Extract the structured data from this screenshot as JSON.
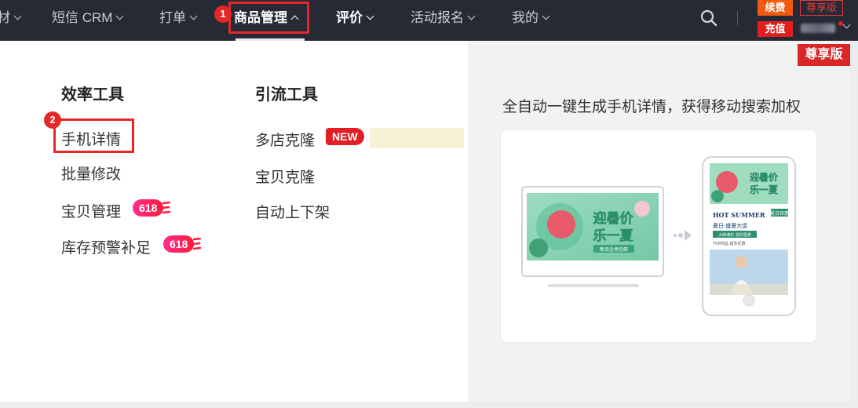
{
  "nav": {
    "items": [
      {
        "label": "材",
        "chevron": true
      },
      {
        "label": "短信 CRM",
        "chevron": true
      },
      {
        "label": "打单",
        "chevron": true
      },
      {
        "label": "商品管理",
        "chevron": "up",
        "active": true
      },
      {
        "label": "评价",
        "chevron": true
      },
      {
        "label": "活动报名",
        "chevron": true
      },
      {
        "label": "我的",
        "chevron": true
      }
    ],
    "step1": "1",
    "renew_label": "续费",
    "vip_outline_label": "尊享版",
    "recharge_label": "充值",
    "vip_badge_label": "尊享版"
  },
  "menu": {
    "efficiency": {
      "title": "效率工具",
      "step2": "2",
      "items": [
        "手机详情",
        "批量修改",
        "宝贝管理",
        "库存预警补足"
      ],
      "tag_618": "618"
    },
    "traffic": {
      "title": "引流工具",
      "items": [
        "多店克隆",
        "宝贝克隆",
        "自动上下架"
      ],
      "tag_new": "NEW"
    }
  },
  "promo": {
    "text": "全自动一键生成手机详情，获得移动搜索加权",
    "banner_title": "迎暑价乐一夏",
    "banner_sub": "新品全场包邮",
    "phone_title": "迎暑价乐一夏",
    "phone_tag": "夏日钜惠",
    "phone_hot": "HOT SUMMER",
    "phone_line": "夏日·盛夏大促",
    "phone_btn": "大牌满折 领优惠券",
    "phone_small": "TOP商品 超多优惠"
  },
  "colors": {
    "nav_bg": "#262a35",
    "highlight": "#e42727",
    "tag_pink": "#ff2c8c",
    "orange": "#f15a10"
  }
}
